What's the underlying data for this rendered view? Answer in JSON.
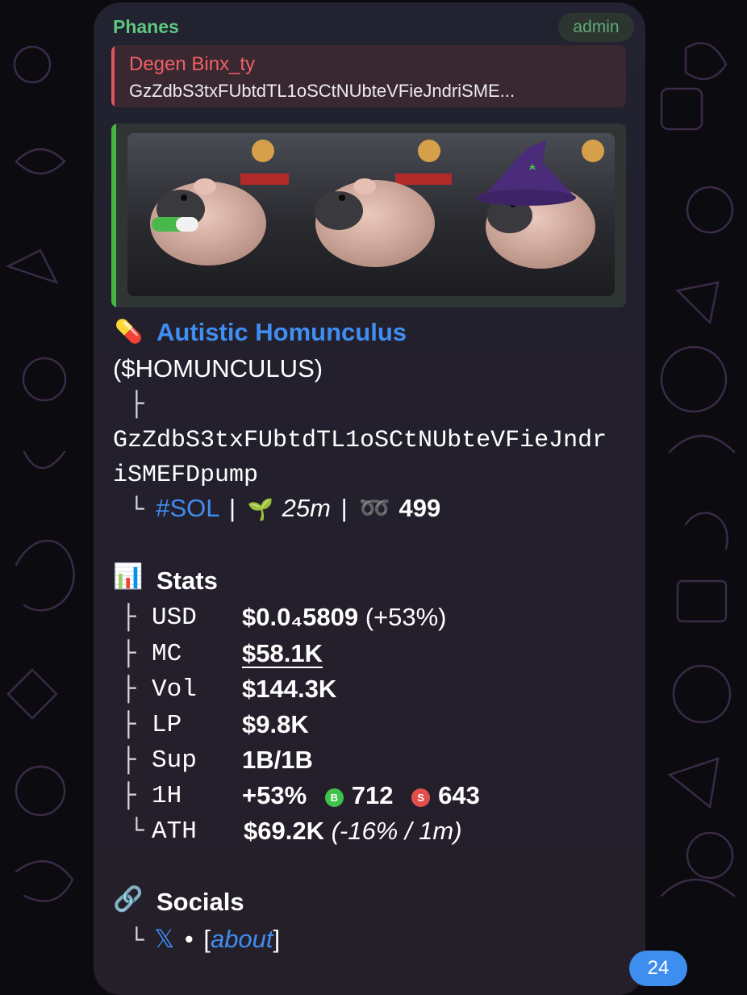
{
  "message": {
    "sender": "Phanes",
    "role_tag": "admin",
    "reply": {
      "name": "Degen Binx_ty",
      "text": "GzZdbS3txFUbtdTL1oSCtNUbteVFieJndriSME..."
    },
    "token": {
      "emoji": "💊",
      "name": "Autistic Homunculus",
      "ticker": "($HOMUNCULUS)",
      "branch": "├",
      "address_line1": "GzZdbS3txFUbtdTL1oSCtNUbteVFieJndr",
      "address_line2": "iSMEFDpump",
      "last_branch": "└",
      "chain": "#SOL",
      "separator": "|",
      "age_emoji": "🌱",
      "age": "25m",
      "holders_emoji": "➿",
      "holders": "499"
    },
    "stats": {
      "emoji": "📊",
      "heading": "Stats",
      "rows": [
        {
          "branch": "├",
          "label": "USD",
          "value": "$0.0₄5809",
          "extra": "(+53%)"
        },
        {
          "branch": "├",
          "label": "MC",
          "value": "$58.1K"
        },
        {
          "branch": "├",
          "label": "Vol",
          "value": "$144.3K"
        },
        {
          "branch": "├",
          "label": "LP",
          "value": "$9.8K"
        },
        {
          "branch": "├",
          "label": "Sup",
          "value": "1B/1B"
        },
        {
          "branch": "├",
          "label": "1H",
          "value": "+53%",
          "buy_badge": "B",
          "buys": "712",
          "sell_badge": "S",
          "sells": "643"
        },
        {
          "branch": "└",
          "label": "ATH",
          "value": "$69.2K",
          "extra": "(-16% / 1m)"
        }
      ]
    },
    "socials": {
      "emoji": "🔗",
      "heading": "Socials",
      "branch": "└",
      "x_label": "𝕏",
      "bullet": "•",
      "about_open": "[",
      "about_link": "about",
      "about_close": "]"
    }
  },
  "unread_count": "24",
  "colors": {
    "bubble": "#231f2c",
    "sender": "#5fc77f",
    "reply_accent": "#ef6166",
    "preview_accent": "#46b548",
    "link": "#3f8ef2",
    "buy": "#3fc34a",
    "sell": "#e34e4b",
    "holders": "#e0855a"
  }
}
